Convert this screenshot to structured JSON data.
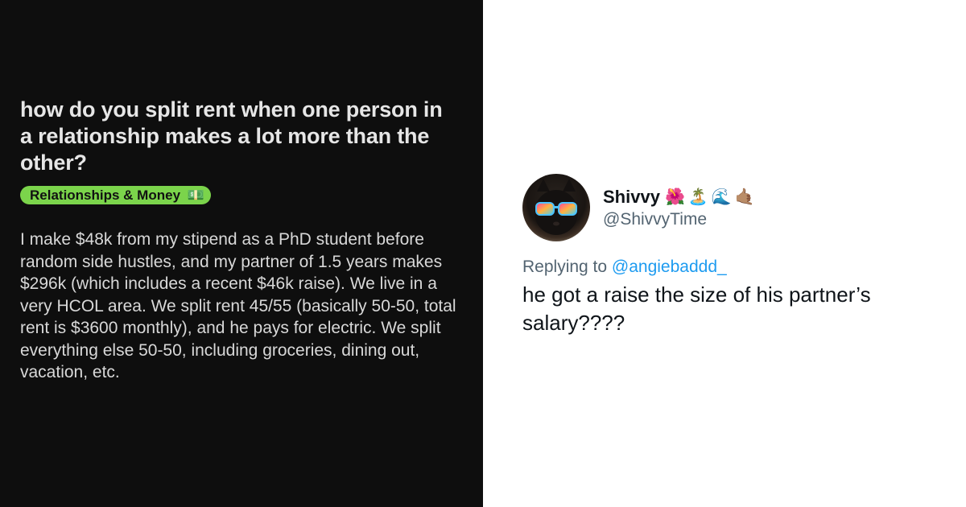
{
  "reddit_post": {
    "title": "how do you split rent when one person in a relationship makes a lot more than the other?",
    "flair": "Relationships & Money",
    "flair_emoji": "💵",
    "body": "I make $48k from my stipend as a PhD student before random side hustles, and my partner of 1.5 years makes $296k (which includes a recent $46k raise). We live in a very HCOL area. We split rent 45/55 (basically 50-50, total rent is $3600 monthly), and he pays for electric. We split everything else 50-50, including groceries, dining out, vacation, etc.",
    "colors": {
      "background": "#0e0e0e",
      "flair": "#7bd44b"
    }
  },
  "tweet": {
    "display_name": "Shivvy",
    "name_emojis": "🌺🏝️🌊🤙🏽",
    "handle": "@ShivvyTime",
    "replying_prefix": "Replying to",
    "replying_handle": "@angiebaddd_",
    "text": "he got a raise the size of his partner’s salary????",
    "avatar": "black-cat-with-sunglasses",
    "colors": {
      "link": "#1d9bf0",
      "secondary": "#536471"
    }
  }
}
